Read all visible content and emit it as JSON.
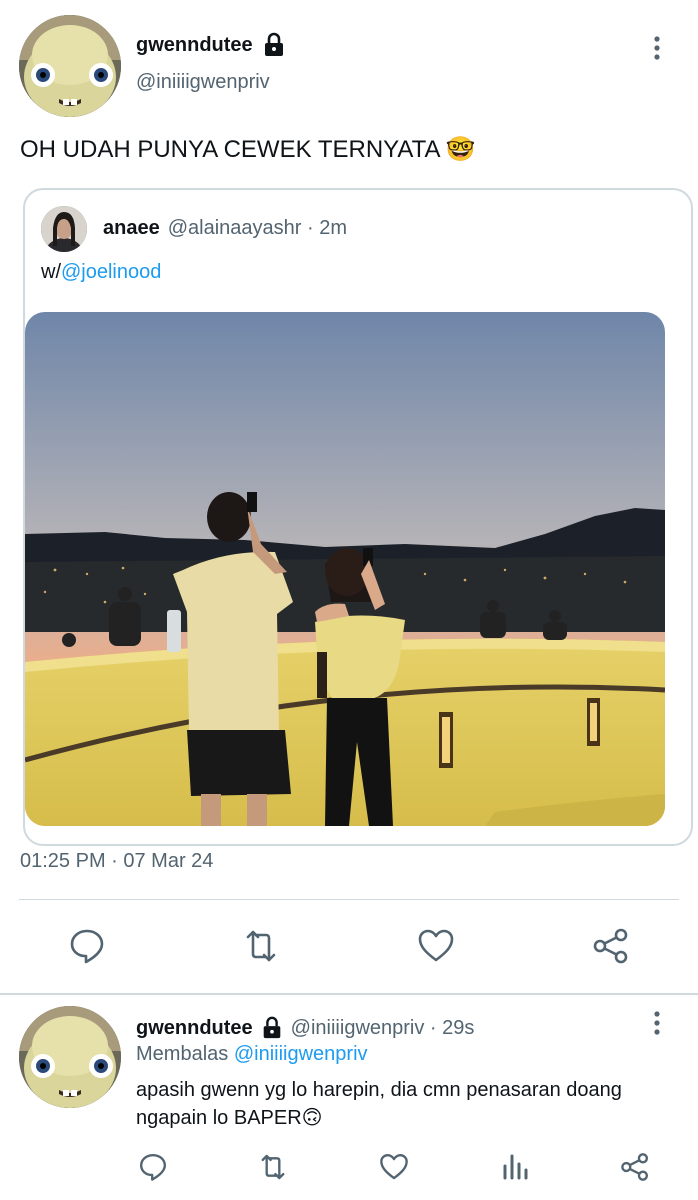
{
  "main_tweet": {
    "display_name": "gwenndutee",
    "handle": "@iniiiigwenpriv",
    "text": "OH UDAH PUNYA CEWEK TERNYATA 🤓",
    "timestamp": "01:25 PM · 07 Mar 24",
    "quoted": {
      "display_name": "anaee",
      "handle_time": "@alainaayashr · 2m",
      "text_prefix": "w/",
      "mention": "@joelinood"
    }
  },
  "main_actions": [
    "reply-icon",
    "retweet-icon",
    "like-icon",
    "share-icon"
  ],
  "reply_tweet": {
    "display_name": "gwenndutee",
    "handle_time": "@iniiiigwenpriv · 29s",
    "replying_label": "Membalas",
    "replying_to": "@iniiiigwenpriv",
    "text_line1": "apasih gwenn yg lo harepin, dia cmn penasaran doang",
    "text_line2": "ngapain lo BAPER🙃"
  },
  "reply_actions": [
    "reply-icon",
    "retweet-icon",
    "like-icon",
    "views-icon",
    "share-icon"
  ],
  "colors": {
    "accent": "#1d9bf0",
    "text": "#0f1419",
    "secondary": "#536471",
    "divider": "#cfd9de"
  }
}
